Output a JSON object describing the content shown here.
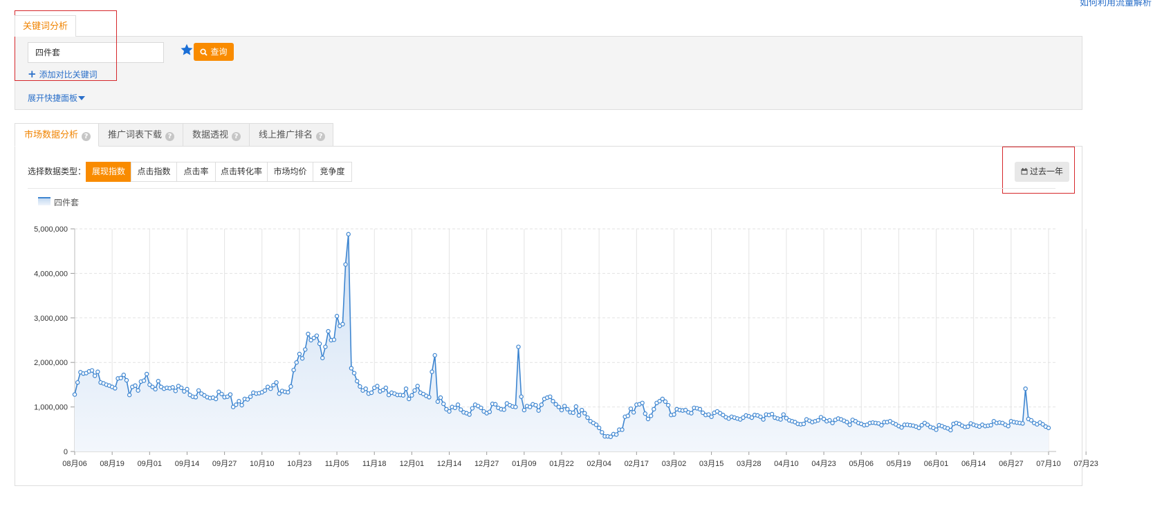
{
  "header": {
    "help_link": "如何利用流量解析"
  },
  "keyword_panel": {
    "tab_label": "关键词分析",
    "keyword_value": "四件套",
    "query_label": "查询",
    "add_compare_label": "添加对比关键词",
    "expand_label": "展开快捷面板"
  },
  "tabs": [
    {
      "label": "市场数据分析",
      "help": "?"
    },
    {
      "label": "推广词表下载",
      "help": "?"
    },
    {
      "label": "数据透视",
      "help": "?"
    },
    {
      "label": "线上推广排名",
      "help": "?"
    }
  ],
  "data_type": {
    "label": "选择数据类型：",
    "options": [
      "展现指数",
      "点击指数",
      "点击率",
      "点击转化率",
      "市场均价",
      "竞争度"
    ],
    "selected": "展现指数"
  },
  "range_button": {
    "label": "过去一年"
  },
  "colors": {
    "accent": "#f98b00",
    "line": "#3d85d0",
    "link": "#2a6fc9",
    "highlight": "#d6262a"
  },
  "chart_data": {
    "type": "area",
    "title": "",
    "xlabel": "",
    "ylabel": "",
    "ylim": [
      0,
      5000000
    ],
    "y_ticks": [
      "0",
      "1,000,000",
      "2,000,000",
      "3,000,000",
      "4,000,000",
      "5,000,000"
    ],
    "categories": [
      "08月06",
      "08月19",
      "09月01",
      "09月14",
      "09月27",
      "10月10",
      "10月23",
      "11月05",
      "11月18",
      "12月01",
      "12月14",
      "12月27",
      "01月09",
      "01月22",
      "02月04",
      "02月17",
      "03月02",
      "03月15",
      "03月28",
      "04月10",
      "04月23",
      "05月06",
      "05月19",
      "06月01",
      "06月14",
      "06月27",
      "07月10",
      "07月23"
    ],
    "grid": true,
    "legend": "top-left",
    "series": [
      {
        "name": "四件套",
        "values": [
          1280000,
          1550000,
          1780000,
          1750000,
          1760000,
          1800000,
          1820000,
          1700000,
          1790000,
          1550000,
          1530000,
          1500000,
          1480000,
          1450000,
          1420000,
          1640000,
          1650000,
          1720000,
          1600000,
          1270000,
          1450000,
          1480000,
          1370000,
          1570000,
          1590000,
          1740000,
          1500000,
          1450000,
          1400000,
          1580000,
          1450000,
          1410000,
          1430000,
          1420000,
          1440000,
          1360000,
          1470000,
          1430000,
          1350000,
          1400000,
          1270000,
          1230000,
          1220000,
          1370000,
          1300000,
          1260000,
          1220000,
          1200000,
          1210000,
          1180000,
          1340000,
          1290000,
          1220000,
          1230000,
          1280000,
          1000000,
          1050000,
          1130000,
          1040000,
          1180000,
          1170000,
          1230000,
          1320000,
          1300000,
          1310000,
          1330000,
          1370000,
          1450000,
          1410000,
          1490000,
          1550000,
          1300000,
          1360000,
          1340000,
          1330000,
          1460000,
          1830000,
          2000000,
          2190000,
          2090000,
          2290000,
          2640000,
          2500000,
          2550000,
          2600000,
          2420000,
          2100000,
          2350000,
          2700000,
          2500000,
          2510000,
          3040000,
          2820000,
          2860000,
          4200000,
          4880000,
          1870000,
          1760000,
          1580000,
          1460000,
          1370000,
          1410000,
          1300000,
          1320000,
          1430000,
          1470000,
          1350000,
          1380000,
          1430000,
          1270000,
          1320000,
          1300000,
          1270000,
          1270000,
          1260000,
          1410000,
          1180000,
          1260000,
          1370000,
          1470000,
          1320000,
          1290000,
          1250000,
          1220000,
          1790000,
          2160000,
          1120000,
          1210000,
          1070000,
          950000,
          900000,
          1000000,
          980000,
          1050000,
          940000,
          880000,
          860000,
          830000,
          970000,
          1050000,
          1020000,
          980000,
          900000,
          860000,
          890000,
          1070000,
          1060000,
          980000,
          950000,
          940000,
          1080000,
          1040000,
          1010000,
          1000000,
          2350000,
          1230000,
          930000,
          1020000,
          1000000,
          1060000,
          1040000,
          920000,
          1050000,
          1180000,
          1210000,
          1230000,
          1130000,
          1060000,
          1000000,
          930000,
          1020000,
          950000,
          880000,
          870000,
          1010000,
          810000,
          930000,
          860000,
          760000,
          680000,
          640000,
          600000,
          530000,
          430000,
          340000,
          340000,
          330000,
          390000,
          380000,
          490000,
          490000,
          780000,
          800000,
          960000,
          880000,
          1050000,
          1060000,
          1090000,
          850000,
          730000,
          800000,
          950000,
          1090000,
          1130000,
          1180000,
          1120000,
          1040000,
          820000,
          830000,
          950000,
          930000,
          920000,
          930000,
          880000,
          860000,
          980000,
          970000,
          950000,
          870000,
          820000,
          830000,
          780000,
          870000,
          900000,
          860000,
          820000,
          770000,
          740000,
          780000,
          760000,
          740000,
          720000,
          760000,
          810000,
          790000,
          760000,
          820000,
          810000,
          780000,
          720000,
          830000,
          820000,
          840000,
          760000,
          740000,
          720000,
          830000,
          750000,
          700000,
          680000,
          660000,
          620000,
          610000,
          620000,
          720000,
          690000,
          660000,
          680000,
          700000,
          770000,
          730000,
          680000,
          700000,
          640000,
          710000,
          740000,
          720000,
          690000,
          660000,
          600000,
          710000,
          680000,
          640000,
          620000,
          590000,
          600000,
          640000,
          650000,
          640000,
          630000,
          590000,
          660000,
          660000,
          680000,
          640000,
          610000,
          570000,
          540000,
          600000,
          600000,
          590000,
          580000,
          560000,
          530000,
          590000,
          640000,
          600000,
          550000,
          530000,
          490000,
          590000,
          570000,
          540000,
          520000,
          480000,
          620000,
          640000,
          620000,
          580000,
          550000,
          560000,
          630000,
          600000,
          580000,
          560000,
          600000,
          570000,
          580000,
          590000,
          680000,
          640000,
          650000,
          640000,
          600000,
          570000,
          680000,
          660000,
          650000,
          640000,
          630000,
          1410000,
          730000,
          700000,
          640000,
          610000,
          650000,
          610000,
          560000,
          530000
        ]
      }
    ]
  }
}
